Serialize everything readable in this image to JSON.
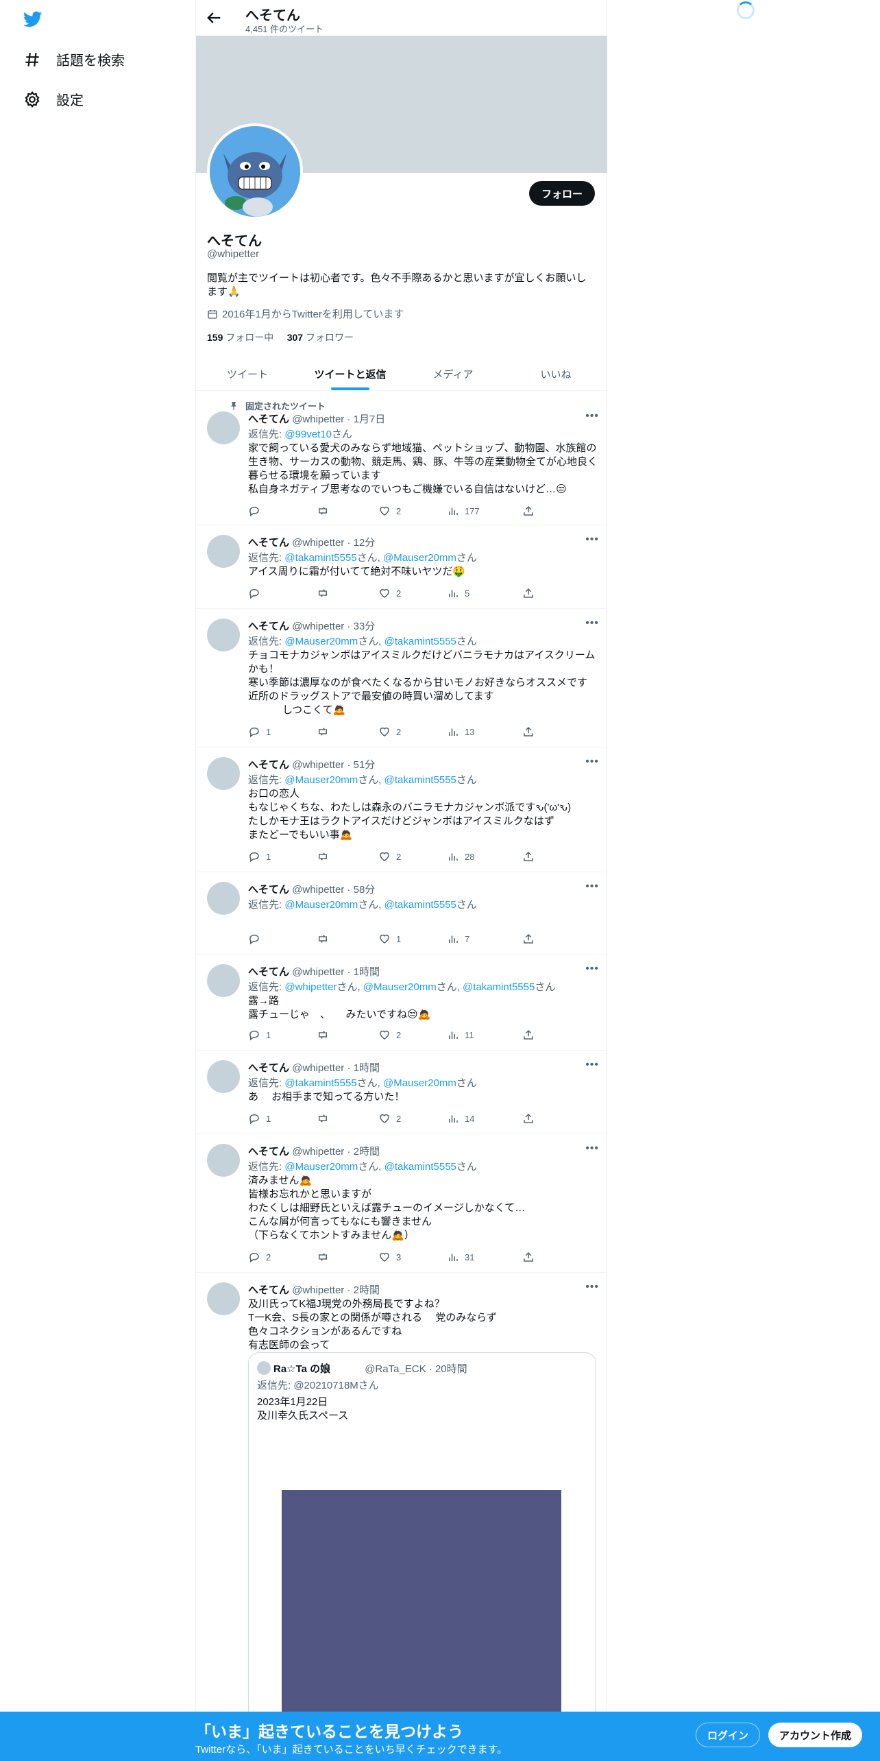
{
  "nav": {
    "explore_label": "話題を検索",
    "settings_label": "設定"
  },
  "header": {
    "title": "へそてん",
    "tweet_count": "4,451 件のツイート"
  },
  "profile": {
    "name": "へそてん",
    "handle": "@whipetter",
    "bio": "閲覧が主でツイートは初心者です。色々不手際あるかと思いますが宜しくお願いします🙏",
    "joined": "2016年1月からTwitterを利用しています",
    "following_count": "159",
    "following_label": " フォロー中",
    "followers_count": "307",
    "followers_label": " フォロワー",
    "follow_button": "フォロー"
  },
  "tabs": [
    "ツイート",
    "ツイートと返信",
    "メディア",
    "いいね"
  ],
  "pinned_label": "固定されたツイート",
  "reply_prefix": "返信先: ",
  "tweets": [
    {
      "name": "へそてん",
      "handle": "@whipetter",
      "time": "· 1月7日",
      "reply_to": "@99vet10",
      "reply_suffix": "さん",
      "body": "家で飼っている愛犬のみならず地域猫、ペットショップ、動物園、水族館の生き物、サーカスの動物、競走馬、鶏、豚、牛等の産業動物全てが心地良く暮らせる環境を願っています\n私自身ネガティブ思考なのでいつもご機嫌でいる自信はないけど…😒",
      "replies": "",
      "retweets": "",
      "likes": "2",
      "views": "177"
    },
    {
      "name": "へそてん",
      "handle": "@whipetter",
      "time": "· 12分",
      "reply_to": "@takamint5555",
      "reply_suffix": "さん, ",
      "reply_to2": "@Mauser20mm",
      "reply_suffix2": "さん",
      "body": "アイス周りに霜が付いてて絶対不味いヤツだ🤑",
      "replies": "",
      "retweets": "",
      "likes": "2",
      "views": "5"
    },
    {
      "name": "へそてん",
      "handle": "@whipetter",
      "time": "· 33分",
      "reply_to": "@Mauser20mm",
      "reply_suffix": "さん, ",
      "reply_to2": "@takamint5555",
      "reply_suffix2": "さん",
      "body": "チョコモナカジャンボはアイスミルクだけどバニラモナカはアイスクリームかも！\n寒い季節は濃厚なのが食べたくなるから甘いモノお好きならオススメです\n近所のドラッグストアで最安値の時買い溜めしてます\n            しつこくて🙇",
      "replies": "1",
      "retweets": "",
      "likes": "2",
      "views": "13"
    },
    {
      "name": "へそてん",
      "handle": "@whipetter",
      "time": "· 51分",
      "reply_to": "@Mauser20mm",
      "reply_suffix": "さん, ",
      "reply_to2": "@takamint5555",
      "reply_suffix2": "さん",
      "body": "お口の恋人\nもなじゃくちな、わたしは森永のバニラモナカジャンボ派ですԅ('ω'ԅ)\nたしかモナ王はラクトアイスだけどジャンボはアイスミルクなはず\nまたどーでもいい事🙇",
      "replies": "1",
      "retweets": "",
      "likes": "2",
      "views": "28"
    },
    {
      "name": "へそてん",
      "handle": "@whipetter",
      "time": "· 58分",
      "reply_to": "@Mauser20mm",
      "reply_suffix": "さん, ",
      "reply_to2": "@takamint5555",
      "reply_suffix2": "さん",
      "body": "",
      "replies": "",
      "retweets": "",
      "likes": "1",
      "views": "7"
    },
    {
      "name": "へそてん",
      "handle": "@whipetter",
      "time": "· 1時間",
      "reply_to": "@whipetter",
      "reply_suffix": "さん, ",
      "reply_to2": "@Mauser20mm",
      "reply_suffix2": "さん, ",
      "reply_to3": "@takamint5555",
      "reply_suffix3": "さん",
      "body": "露→路\n露チューじゃ　、　　みたいですね😒🙇",
      "replies": "1",
      "retweets": "",
      "likes": "2",
      "views": "11"
    },
    {
      "name": "へそてん",
      "handle": "@whipetter",
      "time": "· 1時間",
      "reply_to": "@takamint5555",
      "reply_suffix": "さん, ",
      "reply_to2": "@Mauser20mm",
      "reply_suffix2": "さん",
      "body": "あ　 お相手まで知ってる方いた！",
      "replies": "1",
      "retweets": "",
      "likes": "2",
      "views": "14"
    },
    {
      "name": "へそてん",
      "handle": "@whipetter",
      "time": "· 2時間",
      "reply_to": "@Mauser20mm",
      "reply_suffix": "さん, ",
      "reply_to2": "@takamint5555",
      "reply_suffix2": "さん",
      "body": "済みません🙇\n皆様お忘れかと思いますが\nわたくしは細野氏といえば露チューのイメージしかなくて…\nこんな屑が何言ってもなにも響きません\n（下らなくてホントすみません🙇）",
      "replies": "2",
      "retweets": "",
      "likes": "3",
      "views": "31"
    },
    {
      "name": "へそてん",
      "handle": "@whipetter",
      "time": "· 2時間",
      "body": "及川氏ってK福J現党の外務局長ですよね？\nT一K会、S長の家との関係が噂される　 党のみならず\n色々コネクションがあるんですね\n有志医師の会って"
    }
  ],
  "quote": {
    "name": "Ra☆Ta の娘",
    "handle": "@RaTa_ECK · 20時間",
    "reply": "返信先: @20210718Mさん",
    "body": "2023年1月22日\n及川幸久氏スペース"
  },
  "bottom": {
    "title": "「いま」起きていることを見つけよう",
    "subtitle": "Twitterなら、「いま」起きていることをいち早くチェックできます。",
    "login": "ログイン",
    "signup": "アカウント作成"
  },
  "colors": {
    "accent": "#1d9bf0",
    "banner": "#cfd9de"
  }
}
